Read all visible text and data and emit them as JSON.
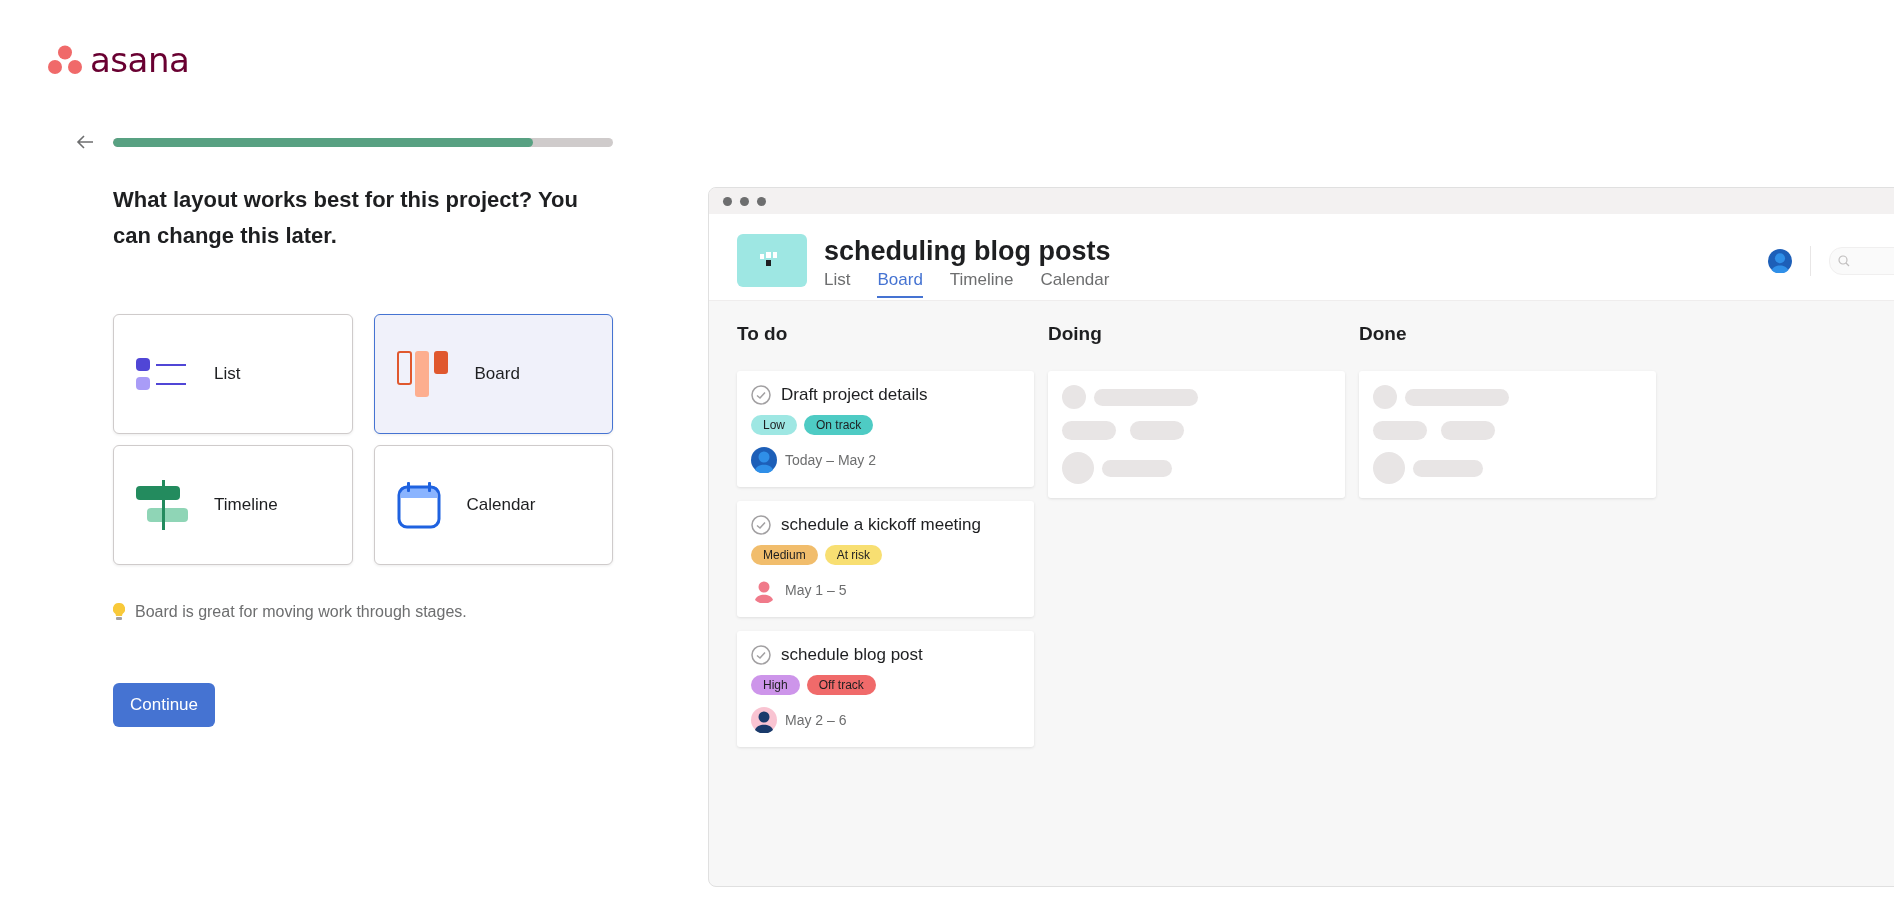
{
  "logo": {
    "text": "asana"
  },
  "progress": {
    "level": 0.84
  },
  "heading": "What layout works best for this project? You can change this later.",
  "layouts": [
    {
      "label": "List",
      "kind": "list",
      "selected": false
    },
    {
      "label": "Board",
      "kind": "board",
      "selected": true
    },
    {
      "label": "Timeline",
      "kind": "timeline",
      "selected": false
    },
    {
      "label": "Calendar",
      "kind": "calendar",
      "selected": false
    }
  ],
  "tip": "Board is great for moving work through stages.",
  "continue_button": "Continue",
  "preview": {
    "title": "scheduling blog posts",
    "tabs": [
      {
        "label": "List",
        "selected": false
      },
      {
        "label": "Board",
        "selected": true
      },
      {
        "label": "Timeline",
        "selected": false
      },
      {
        "label": "Calendar",
        "selected": false
      }
    ],
    "columns": [
      {
        "title": "To do",
        "cards": [
          {
            "kind": "task",
            "name": "Draft project details",
            "tags": [
              {
                "label": "Low",
                "color": "#9ee7e3"
              },
              {
                "label": "On track",
                "color": "#4ecbc4"
              }
            ],
            "date": "Today – May 2"
          },
          {
            "kind": "task",
            "name": "schedule a kickoff meeting",
            "tags": [
              {
                "label": "Medium",
                "color": "#f1bd6c"
              },
              {
                "label": "At risk",
                "color": "#f8df72"
              }
            ],
            "date": "May 1 – 5"
          },
          {
            "kind": "task",
            "name": "schedule blog post",
            "tags": [
              {
                "label": "High",
                "color": "#cd95ea"
              },
              {
                "label": "Off track",
                "color": "#f06a6a"
              }
            ],
            "date": "May 2 – 6"
          }
        ]
      },
      {
        "title": "Doing",
        "cards": [
          {
            "kind": "skeleton"
          }
        ]
      },
      {
        "title": "Done",
        "cards": [
          {
            "kind": "skeleton"
          }
        ]
      }
    ]
  }
}
